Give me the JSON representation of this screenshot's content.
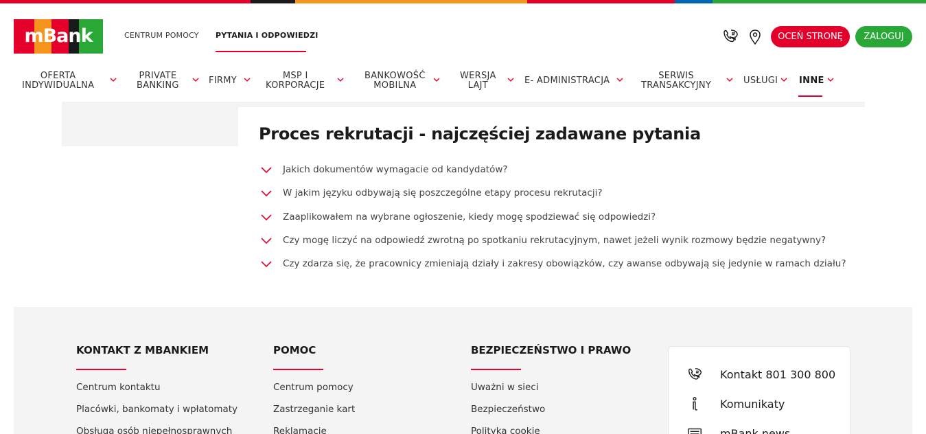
{
  "brand": {
    "logo_text": "mBank",
    "stripe_colors": [
      "#e4002b",
      "#1a1a1a",
      "#f7941d",
      "#e4002b",
      "#0066b3",
      "#29a838"
    ],
    "logo_colors": [
      "#e4002b",
      "#f7941d",
      "#e4002b",
      "#1a1a1a",
      "#29a838"
    ],
    "accent": "#e4002b",
    "green": "#29a838"
  },
  "header": {
    "links": [
      {
        "label": "CENTRUM POMOCY",
        "active": false
      },
      {
        "label": "PYTANIA I ODPOWIEDZI",
        "active": true
      }
    ],
    "icons": [
      "phone-chat-icon",
      "location-pin-icon"
    ],
    "rate_button": "OCEŃ STRONĘ",
    "login_button": "ZALOGUJ"
  },
  "nav": {
    "items": [
      {
        "line1": "OFERTA",
        "line2": "INDYWIDUALNA"
      },
      {
        "line1": "PRIVATE",
        "line2": "BANKING"
      },
      {
        "line1": "FIRMY",
        "line2": ""
      },
      {
        "line1": "MSP I",
        "line2": "KORPORACJE"
      },
      {
        "line1": "BANKOWOŚĆ",
        "line2": "MOBILNA"
      },
      {
        "line1": "WERSJA",
        "line2": "LAJT"
      },
      {
        "line1": "E- ADMINISTRACJA",
        "line2": ""
      },
      {
        "line1": "SERWIS",
        "line2": "TRANSAKCYJNY"
      },
      {
        "line1": "USŁUGI",
        "line2": ""
      },
      {
        "line1": "INNE",
        "line2": "",
        "active": true
      }
    ]
  },
  "main": {
    "title": "Proces rekrutacji - najczęściej zadawane pytania",
    "faq": [
      "Jakich dokumentów wymagacie od kandydatów?",
      "W jakim języku odbywają się poszczególne etapy procesu rekrutacji?",
      "Zaaplikowałem na wybrane ogłoszenie, kiedy mogę spodziewać się odpowiedzi?",
      "Czy mogę liczyć na odpowiedź zwrotną po spotkaniu rekrutacyjnym, nawet jeżeli wynik rozmowy będzie negatywny?",
      "Czy zdarza się, że pracownicy zmieniają działy i zakresy obowiązków, czy awanse odbywają się jedynie w ramach działu?"
    ]
  },
  "footer": {
    "columns": [
      {
        "title": "KONTAKT Z MBANKIEM",
        "links": [
          "Centrum kontaktu",
          "Placówki, bankomaty i wpłatomaty",
          "Obsługa osób niepełnosprawnych"
        ]
      },
      {
        "title": "POMOC",
        "links": [
          "Centrum pomocy",
          "Zastrzeganie kart",
          "Reklamacje"
        ]
      },
      {
        "title": "BEZPIECZEŃSTWO I PRAWO",
        "links": [
          "Uważni w sieci",
          "Bezpieczeństwo",
          "Polityka cookie"
        ]
      }
    ],
    "contact_card": [
      {
        "icon": "phone-chat-icon",
        "label": "Kontakt 801 300 800"
      },
      {
        "icon": "info-icon",
        "label": "Komunikaty"
      },
      {
        "icon": "newspaper-icon",
        "label": "mBank news"
      }
    ]
  }
}
